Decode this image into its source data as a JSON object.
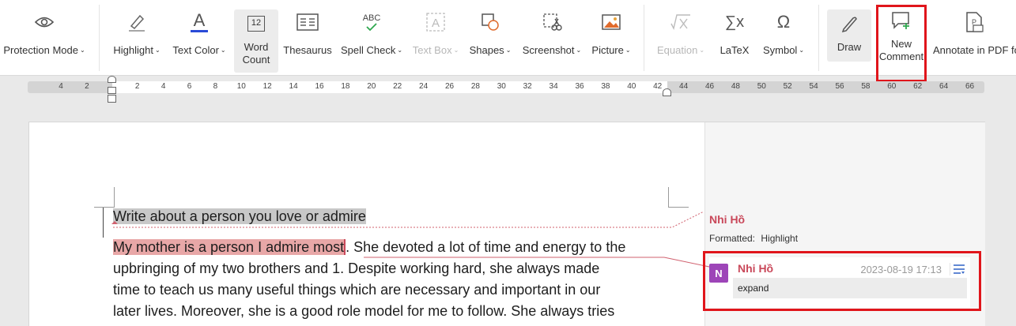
{
  "ribbon": {
    "protection_mode": "Protection Mode",
    "highlight": "Highlight",
    "text_color": "Text Color",
    "word_count_1": "Word",
    "word_count_2": "Count",
    "thesaurus": "Thesaurus",
    "spell_check": "Spell Check",
    "text_box": "Text Box",
    "shapes": "Shapes",
    "screenshot": "Screenshot",
    "picture": "Picture",
    "equation": "Equation",
    "latex": "LaTeX",
    "symbol": "Symbol",
    "draw": "Draw",
    "new_comment_1": "New",
    "new_comment_2": "Comment",
    "annotate_pdf": "Annotate in PDF fo",
    "caret": "⌄",
    "word_count_icon_text": "12",
    "spell_icon_text": "ABC",
    "textcolor_icon_text": "A",
    "symbol_icon_text": "Ω",
    "latex_icon_text": "∑x"
  },
  "ruler": {
    "ticks": [
      "4",
      "2",
      "2",
      "4",
      "6",
      "8",
      "10",
      "12",
      "14",
      "16",
      "18",
      "20",
      "22",
      "24",
      "26",
      "28",
      "30",
      "32",
      "34",
      "36",
      "38",
      "40",
      "42",
      "44",
      "46",
      "48",
      "50",
      "52",
      "54",
      "56",
      "58",
      "60",
      "62",
      "64",
      "66"
    ]
  },
  "document": {
    "line1": "Write about a person you love or admire",
    "line2_highlight": "My mother is a person I admire most",
    "line2_rest": ". She devoted a lot of time and energy to the",
    "line3": "upbringing of my two brothers and 1. Despite working hard, she always made",
    "line4": "time to teach us many useful things which are necessary and important in our",
    "line5": "later lives. Moreover, she is a good role model for me to follow. She always tries"
  },
  "comments": {
    "revision_author": "Nhi Hồ",
    "revision_formatted_label": "Formatted:",
    "revision_formatted_value": "Highlight",
    "comment_author": "Nhi Hồ",
    "comment_avatar_letter": "N",
    "comment_date": "2023-08-19 17:13",
    "comment_text": "expand"
  },
  "colors": {
    "accent_red": "#e0151b",
    "author_color": "#c9485a",
    "avatar_color": "#9d45b8",
    "text_color_icon": "#2a4bd7",
    "new_comment_plus": "#2fa84f"
  }
}
